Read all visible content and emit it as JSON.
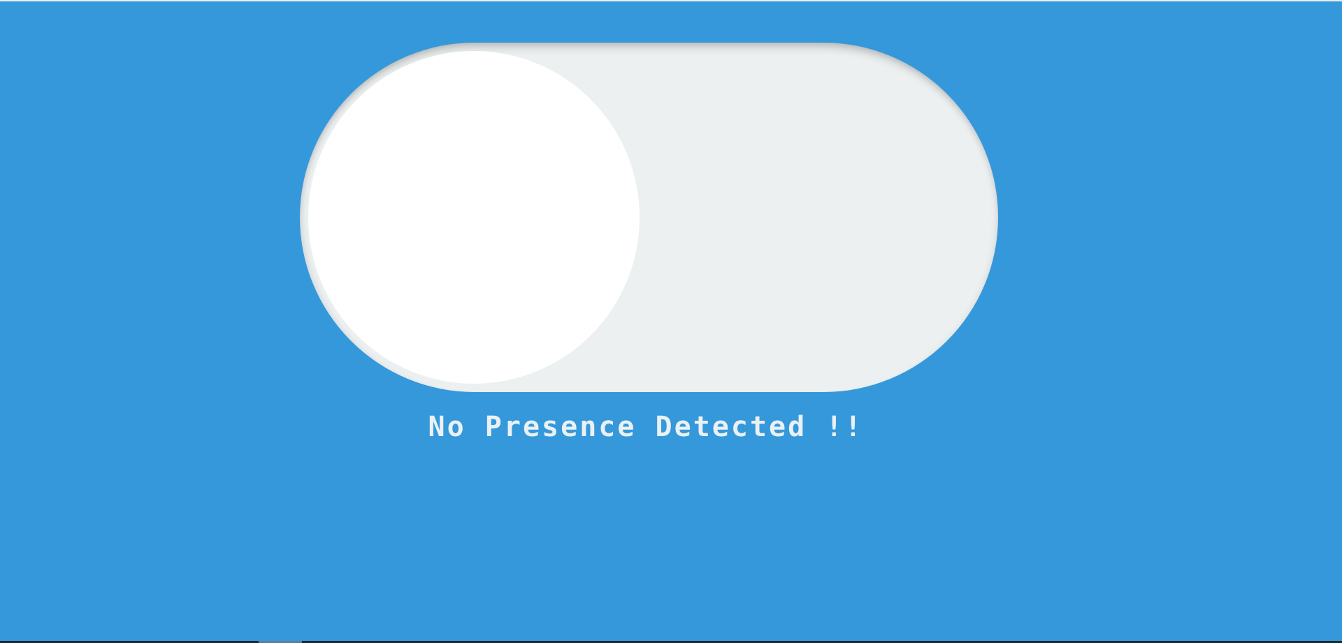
{
  "presence_switch": {
    "state": "off",
    "knob_position": "left"
  },
  "status": {
    "text": "No Presence Detected !!"
  },
  "colors": {
    "background": "#3598db",
    "track": "#ecf0f1",
    "knob": "#ffffff",
    "text": "#eaf1f4"
  }
}
